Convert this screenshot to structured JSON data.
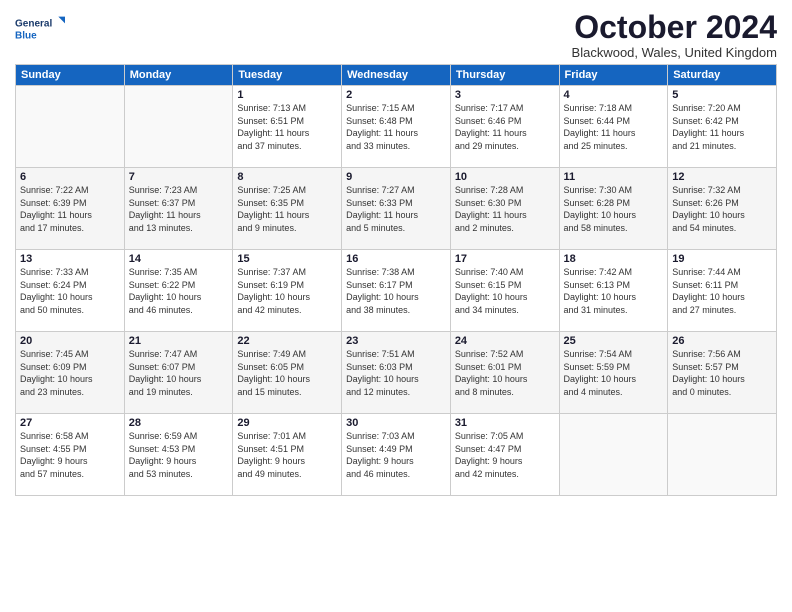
{
  "logo": {
    "line1": "General",
    "line2": "Blue"
  },
  "title": "October 2024",
  "subtitle": "Blackwood, Wales, United Kingdom",
  "days_of_week": [
    "Sunday",
    "Monday",
    "Tuesday",
    "Wednesday",
    "Thursday",
    "Friday",
    "Saturday"
  ],
  "weeks": [
    [
      {
        "num": "",
        "info": ""
      },
      {
        "num": "",
        "info": ""
      },
      {
        "num": "1",
        "info": "Sunrise: 7:13 AM\nSunset: 6:51 PM\nDaylight: 11 hours\nand 37 minutes."
      },
      {
        "num": "2",
        "info": "Sunrise: 7:15 AM\nSunset: 6:48 PM\nDaylight: 11 hours\nand 33 minutes."
      },
      {
        "num": "3",
        "info": "Sunrise: 7:17 AM\nSunset: 6:46 PM\nDaylight: 11 hours\nand 29 minutes."
      },
      {
        "num": "4",
        "info": "Sunrise: 7:18 AM\nSunset: 6:44 PM\nDaylight: 11 hours\nand 25 minutes."
      },
      {
        "num": "5",
        "info": "Sunrise: 7:20 AM\nSunset: 6:42 PM\nDaylight: 11 hours\nand 21 minutes."
      }
    ],
    [
      {
        "num": "6",
        "info": "Sunrise: 7:22 AM\nSunset: 6:39 PM\nDaylight: 11 hours\nand 17 minutes."
      },
      {
        "num": "7",
        "info": "Sunrise: 7:23 AM\nSunset: 6:37 PM\nDaylight: 11 hours\nand 13 minutes."
      },
      {
        "num": "8",
        "info": "Sunrise: 7:25 AM\nSunset: 6:35 PM\nDaylight: 11 hours\nand 9 minutes."
      },
      {
        "num": "9",
        "info": "Sunrise: 7:27 AM\nSunset: 6:33 PM\nDaylight: 11 hours\nand 5 minutes."
      },
      {
        "num": "10",
        "info": "Sunrise: 7:28 AM\nSunset: 6:30 PM\nDaylight: 11 hours\nand 2 minutes."
      },
      {
        "num": "11",
        "info": "Sunrise: 7:30 AM\nSunset: 6:28 PM\nDaylight: 10 hours\nand 58 minutes."
      },
      {
        "num": "12",
        "info": "Sunrise: 7:32 AM\nSunset: 6:26 PM\nDaylight: 10 hours\nand 54 minutes."
      }
    ],
    [
      {
        "num": "13",
        "info": "Sunrise: 7:33 AM\nSunset: 6:24 PM\nDaylight: 10 hours\nand 50 minutes."
      },
      {
        "num": "14",
        "info": "Sunrise: 7:35 AM\nSunset: 6:22 PM\nDaylight: 10 hours\nand 46 minutes."
      },
      {
        "num": "15",
        "info": "Sunrise: 7:37 AM\nSunset: 6:19 PM\nDaylight: 10 hours\nand 42 minutes."
      },
      {
        "num": "16",
        "info": "Sunrise: 7:38 AM\nSunset: 6:17 PM\nDaylight: 10 hours\nand 38 minutes."
      },
      {
        "num": "17",
        "info": "Sunrise: 7:40 AM\nSunset: 6:15 PM\nDaylight: 10 hours\nand 34 minutes."
      },
      {
        "num": "18",
        "info": "Sunrise: 7:42 AM\nSunset: 6:13 PM\nDaylight: 10 hours\nand 31 minutes."
      },
      {
        "num": "19",
        "info": "Sunrise: 7:44 AM\nSunset: 6:11 PM\nDaylight: 10 hours\nand 27 minutes."
      }
    ],
    [
      {
        "num": "20",
        "info": "Sunrise: 7:45 AM\nSunset: 6:09 PM\nDaylight: 10 hours\nand 23 minutes."
      },
      {
        "num": "21",
        "info": "Sunrise: 7:47 AM\nSunset: 6:07 PM\nDaylight: 10 hours\nand 19 minutes."
      },
      {
        "num": "22",
        "info": "Sunrise: 7:49 AM\nSunset: 6:05 PM\nDaylight: 10 hours\nand 15 minutes."
      },
      {
        "num": "23",
        "info": "Sunrise: 7:51 AM\nSunset: 6:03 PM\nDaylight: 10 hours\nand 12 minutes."
      },
      {
        "num": "24",
        "info": "Sunrise: 7:52 AM\nSunset: 6:01 PM\nDaylight: 10 hours\nand 8 minutes."
      },
      {
        "num": "25",
        "info": "Sunrise: 7:54 AM\nSunset: 5:59 PM\nDaylight: 10 hours\nand 4 minutes."
      },
      {
        "num": "26",
        "info": "Sunrise: 7:56 AM\nSunset: 5:57 PM\nDaylight: 10 hours\nand 0 minutes."
      }
    ],
    [
      {
        "num": "27",
        "info": "Sunrise: 6:58 AM\nSunset: 4:55 PM\nDaylight: 9 hours\nand 57 minutes."
      },
      {
        "num": "28",
        "info": "Sunrise: 6:59 AM\nSunset: 4:53 PM\nDaylight: 9 hours\nand 53 minutes."
      },
      {
        "num": "29",
        "info": "Sunrise: 7:01 AM\nSunset: 4:51 PM\nDaylight: 9 hours\nand 49 minutes."
      },
      {
        "num": "30",
        "info": "Sunrise: 7:03 AM\nSunset: 4:49 PM\nDaylight: 9 hours\nand 46 minutes."
      },
      {
        "num": "31",
        "info": "Sunrise: 7:05 AM\nSunset: 4:47 PM\nDaylight: 9 hours\nand 42 minutes."
      },
      {
        "num": "",
        "info": ""
      },
      {
        "num": "",
        "info": ""
      }
    ]
  ]
}
